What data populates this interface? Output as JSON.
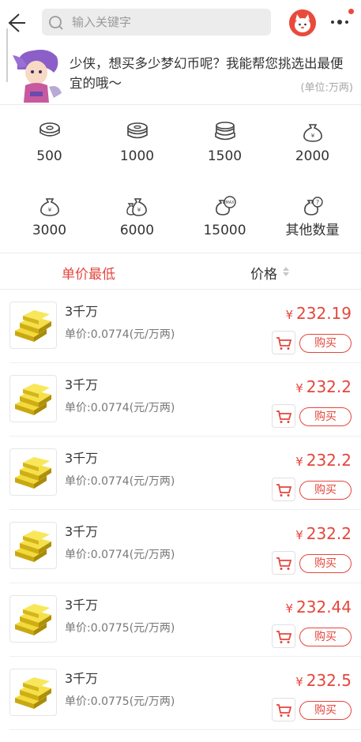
{
  "search": {
    "placeholder": "输入关键字"
  },
  "intro": {
    "text": "少侠，想买多少梦幻币呢？我能帮您挑选出最便宜的哦～",
    "unit": "(单位:万两)"
  },
  "quantities": [
    {
      "label": "500",
      "icon": "coin-stack-icon"
    },
    {
      "label": "1000",
      "icon": "coin-stack-icon"
    },
    {
      "label": "1500",
      "icon": "coin-stack-icon"
    },
    {
      "label": "2000",
      "icon": "money-bag-icon"
    },
    {
      "label": "3000",
      "icon": "money-bag-icon"
    },
    {
      "label": "6000",
      "icon": "money-bags-icon"
    },
    {
      "label": "15000",
      "icon": "max-bag-icon"
    },
    {
      "label": "其他数量",
      "icon": "question-bag-icon"
    }
  ],
  "sort": {
    "lowest_unit_price": "单价最低",
    "price": "价格"
  },
  "listings": [
    {
      "title": "3千万",
      "unit_price": "单价:0.0774(元/万两)",
      "currency": "¥",
      "price": "232.19",
      "buy": "购买"
    },
    {
      "title": "3千万",
      "unit_price": "单价:0.0774(元/万两)",
      "currency": "¥",
      "price": "232.2",
      "buy": "购买"
    },
    {
      "title": "3千万",
      "unit_price": "单价:0.0774(元/万两)",
      "currency": "¥",
      "price": "232.2",
      "buy": "购买"
    },
    {
      "title": "3千万",
      "unit_price": "单价:0.0774(元/万两)",
      "currency": "¥",
      "price": "232.2",
      "buy": "购买"
    },
    {
      "title": "3千万",
      "unit_price": "单价:0.0775(元/万两)",
      "currency": "¥",
      "price": "232.44",
      "buy": "购买"
    },
    {
      "title": "3千万",
      "unit_price": "单价:0.0775(元/万两)",
      "currency": "¥",
      "price": "232.5",
      "buy": "购买"
    }
  ],
  "colors": {
    "accent": "#e5463c",
    "gold": "#e8c81f"
  }
}
